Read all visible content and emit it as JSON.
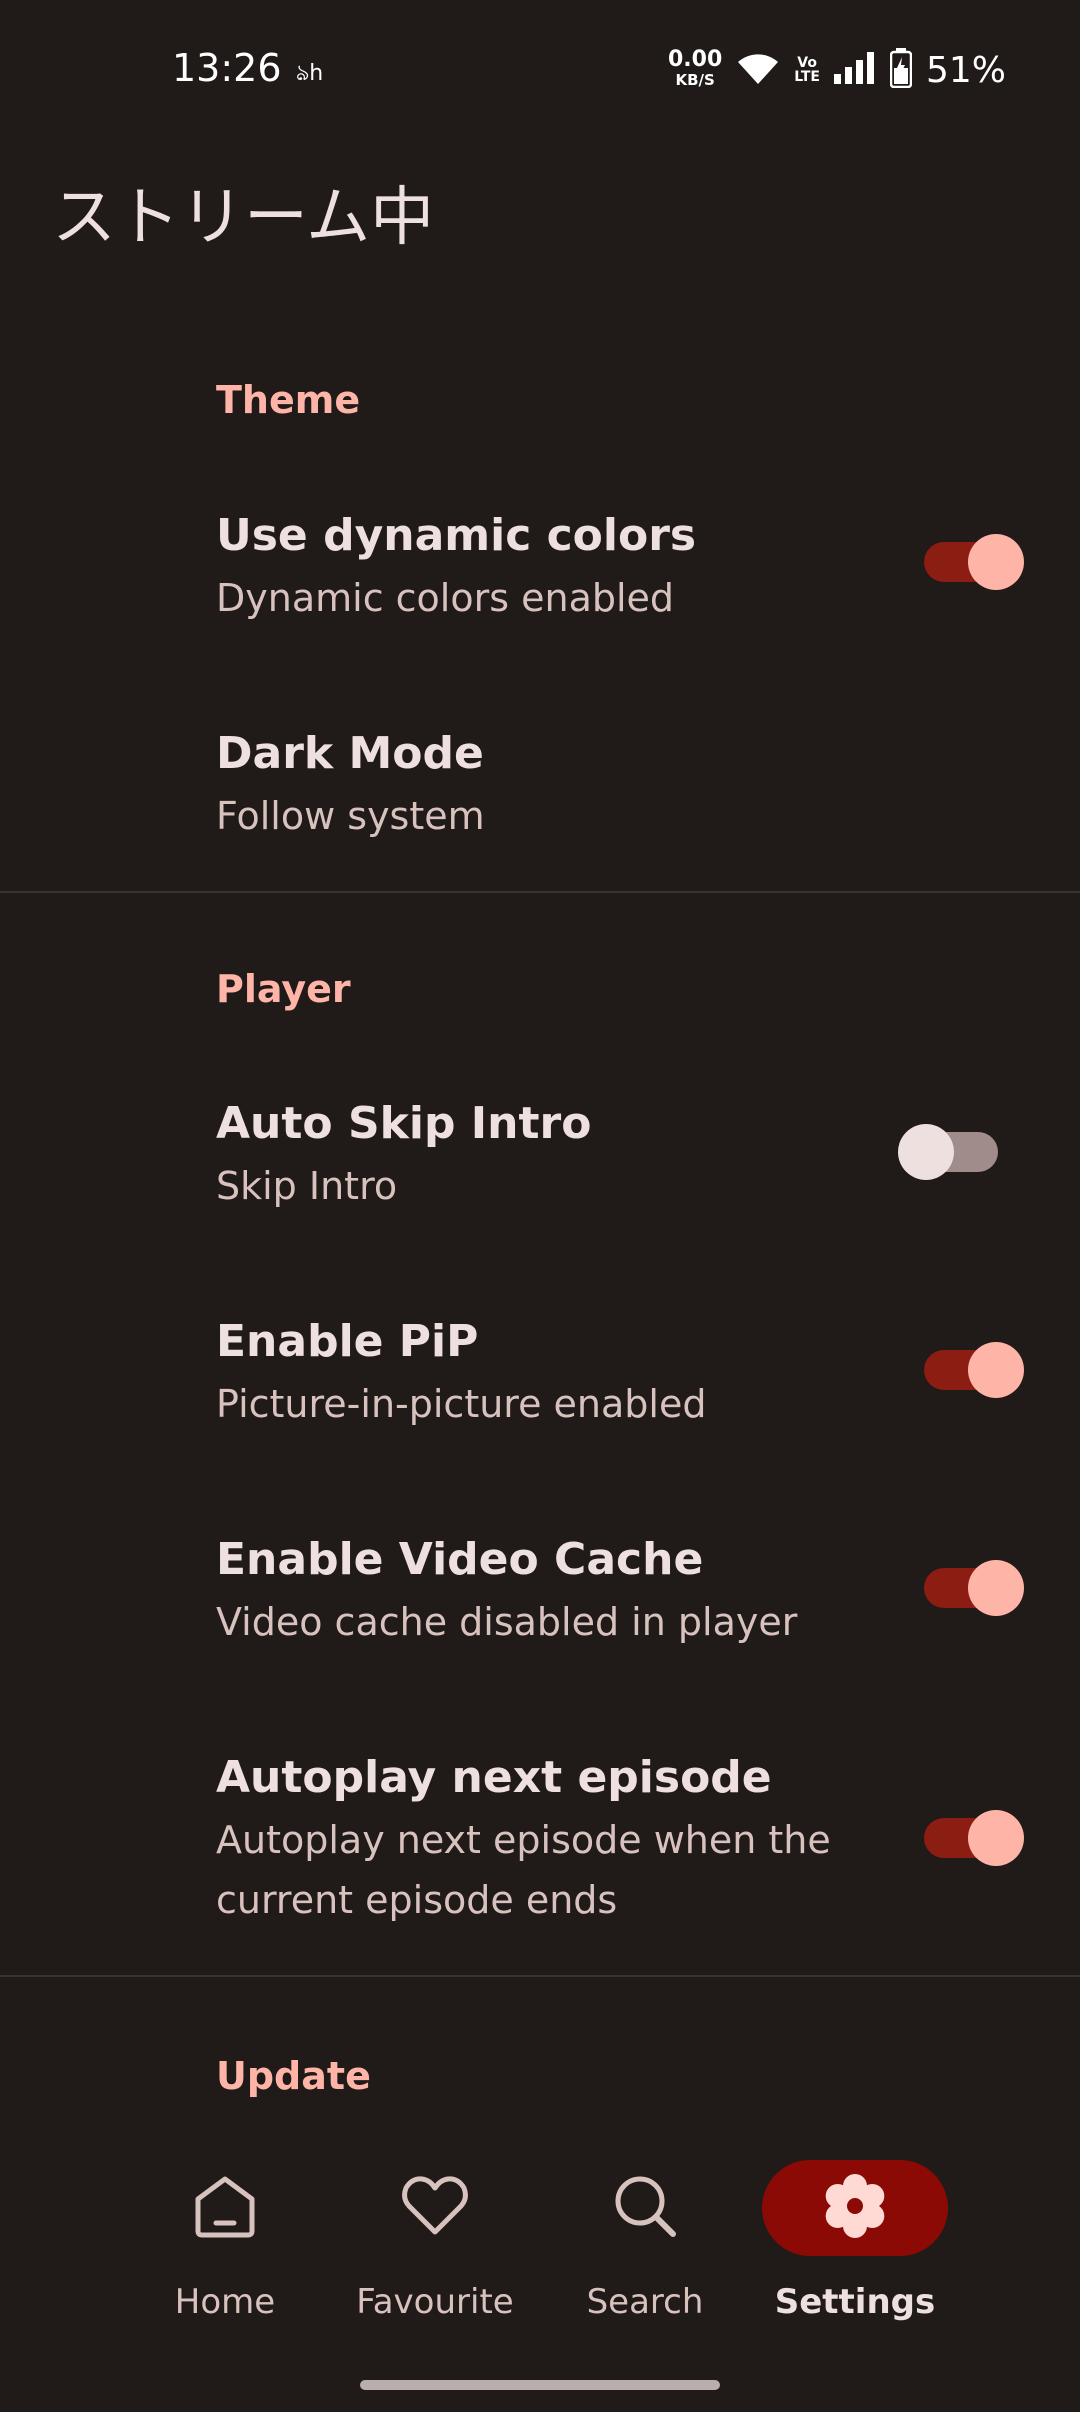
{
  "status_bar": {
    "time": "13:26",
    "extra_icon": "ঌh",
    "net_speed_value": "0.00",
    "net_speed_unit": "KB/S",
    "volte_top": "Vo",
    "volte_bottom": "LTE",
    "battery": "51%"
  },
  "app": {
    "title": "ストリーム中"
  },
  "sections": {
    "theme": {
      "header": "Theme",
      "dynamic_colors": {
        "title": "Use dynamic colors",
        "summary": "Dynamic colors enabled",
        "enabled": true
      },
      "dark_mode": {
        "title": "Dark Mode",
        "summary": "Follow system"
      }
    },
    "player": {
      "header": "Player",
      "auto_skip_intro": {
        "title": "Auto Skip Intro",
        "summary": "Skip Intro",
        "enabled": false
      },
      "enable_pip": {
        "title": "Enable PiP",
        "summary": "Picture-in-picture enabled",
        "enabled": true
      },
      "video_cache": {
        "title": "Enable Video Cache",
        "summary": "Video cache disabled in player",
        "enabled": true
      },
      "autoplay": {
        "title": "Autoplay next episode",
        "summary": "Autoplay next episode when the current episode ends",
        "enabled": true
      }
    },
    "update": {
      "header": "Update"
    }
  },
  "nav": {
    "home": "Home",
    "favourite": "Favourite",
    "search": "Search",
    "settings": "Settings",
    "active": "settings"
  },
  "colors": {
    "background": "#201a19",
    "accent": "#ffb4a8",
    "switch_track_on": "#8c1d12",
    "nav_active_pill": "#8b0a05"
  },
  "icons": [
    "home-icon",
    "heart-icon",
    "search-icon",
    "gear-icon",
    "wifi-icon",
    "signal-icon",
    "battery-icon"
  ]
}
